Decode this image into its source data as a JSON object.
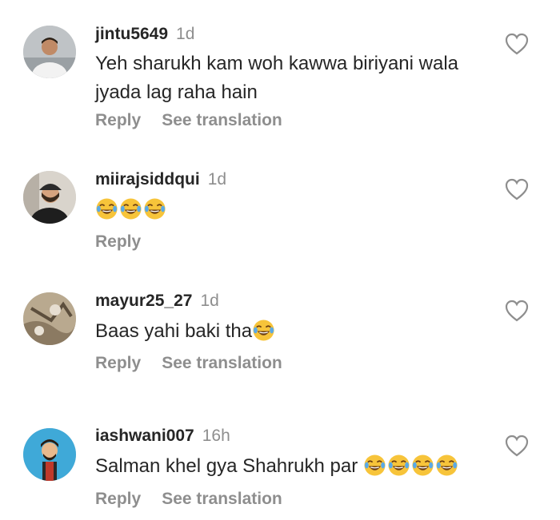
{
  "comments": [
    {
      "username": "jintu5649",
      "time": "1d",
      "text": "Yeh sharukh kam woh kawwa biriyani wala jyada lag raha hain",
      "emoji_count": 0,
      "reply_label": "Reply",
      "translate_label": "See translation",
      "avatar_icon": "avatar-man-white-shirt"
    },
    {
      "username": "miirajsiddqui",
      "time": "1d",
      "text": "",
      "emoji_count": 3,
      "reply_label": "Reply",
      "translate_label": "",
      "avatar_icon": "avatar-man-cap"
    },
    {
      "username": "mayur25_27",
      "time": "1d",
      "text": "Baas yahi baki tha",
      "emoji_count": 1,
      "reply_label": "Reply",
      "translate_label": "See translation",
      "avatar_icon": "avatar-photo"
    },
    {
      "username": "iashwani007",
      "time": "16h",
      "text": "Salman khel gya Shahrukh par",
      "emoji_count": 4,
      "reply_label": "Reply",
      "translate_label": "See translation",
      "avatar_icon": "avatar-cartoon"
    }
  ],
  "emoji_icon": "face-with-tears-of-joy",
  "heart_icon": "heart-outline-icon"
}
